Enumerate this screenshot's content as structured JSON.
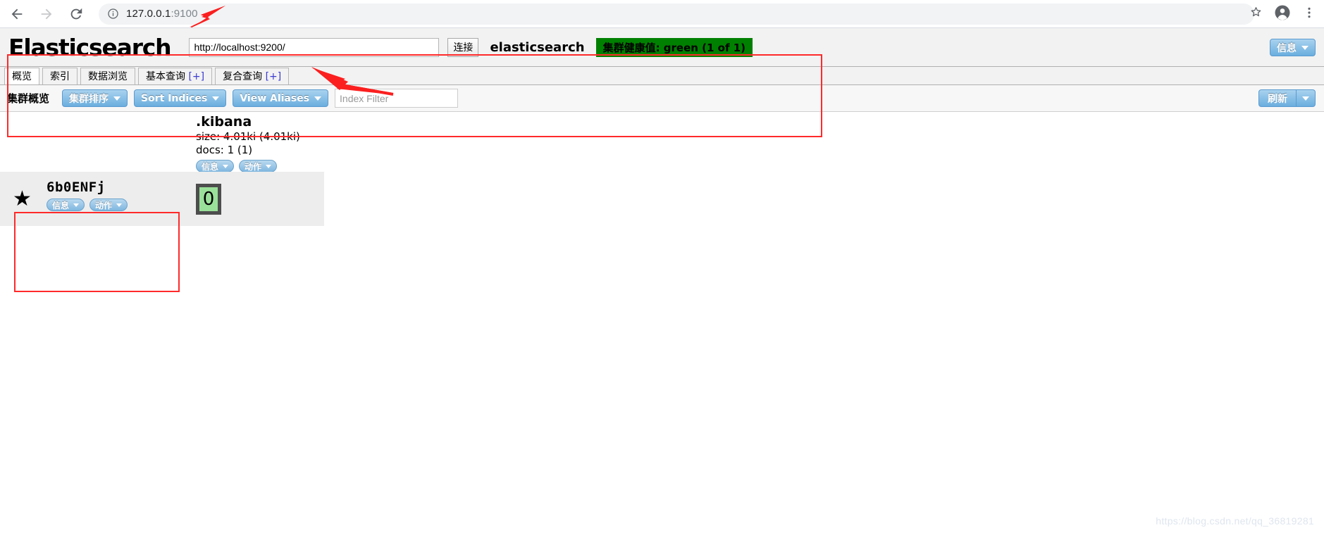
{
  "browser": {
    "back_icon": "back-arrow-icon",
    "forward_icon": "forward-arrow-icon",
    "reload_icon": "reload-icon",
    "site_info_icon": "info-circle-icon",
    "url_host": "127.0.0.1",
    "url_port": ":9100",
    "bookmark_icon": "star-outline-icon",
    "profile_icon": "profile-avatar-icon",
    "menu_icon": "three-dots-menu-icon"
  },
  "app": {
    "logo": "Elasticsearch",
    "host_value": "http://localhost:9200/",
    "host_placeholder": "http://localhost:9200/",
    "connect_label": "连接",
    "cluster_name": "elasticsearch",
    "health_badge": "集群健康值: green (1 of 1)",
    "health_color": "#008000",
    "info_button": "信息"
  },
  "tabs": [
    {
      "label": "概览",
      "plus": "",
      "active": true
    },
    {
      "label": "索引",
      "plus": "",
      "active": false
    },
    {
      "label": "数据浏览",
      "plus": "",
      "active": false
    },
    {
      "label": "基本查询",
      "plus": "[+]",
      "active": false
    },
    {
      "label": "复合查询",
      "plus": "[+]",
      "active": false
    }
  ],
  "toolbar": {
    "overview_label": "集群概览",
    "cluster_sort_label": "集群排序",
    "sort_indices_label": "Sort Indices",
    "view_aliases_label": "View Aliases",
    "index_filter_value": "",
    "index_filter_placeholder": "Index Filter",
    "refresh_label": "刷新"
  },
  "index": {
    "name": ".kibana",
    "size_line": "size: 4.01ki (4.01ki)",
    "docs_line": "docs: 1 (1)",
    "info_label": "信息",
    "action_label": "动作"
  },
  "node": {
    "star_glyph": "★",
    "name": "6b0ENFj",
    "info_label": "信息",
    "action_label": "动作"
  },
  "shard": {
    "label": "0",
    "state_color": "#9ae09a"
  },
  "watermark": "https://blog.csdn.net/qq_36819281"
}
